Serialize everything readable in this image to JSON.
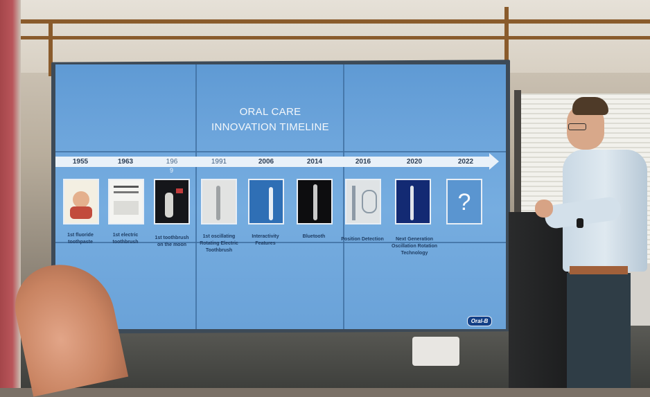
{
  "slide": {
    "title_line1": "ORAL CARE",
    "title_line2": "INNOVATION TIMELINE",
    "brand_logo": "Oral-B",
    "timeline": [
      {
        "year": "1955",
        "caption": "1st fluoride toothpaste"
      },
      {
        "year": "1963",
        "caption": "1st electric toothbrush"
      },
      {
        "year": "196",
        "year_suffix": "9",
        "caption": "1st toothbrush on the moon"
      },
      {
        "year": "1991",
        "caption": "1st oscillating Rotating Electric Toothbrush"
      },
      {
        "year": "2006",
        "caption": "Interactivity Features"
      },
      {
        "year": "2014",
        "caption": "Bluetooth"
      },
      {
        "year": "2016",
        "caption": "Position Detection"
      },
      {
        "year": "2020",
        "caption": "Next Generation Oscillation Rotation Technology"
      },
      {
        "year": "2022",
        "caption": "?"
      }
    ]
  },
  "colors": {
    "screen_blue": "#6ea6dc",
    "arrow_band": "#e9f1f9",
    "year_text": "#2c3e55",
    "oralb_blue": "#133f86"
  }
}
